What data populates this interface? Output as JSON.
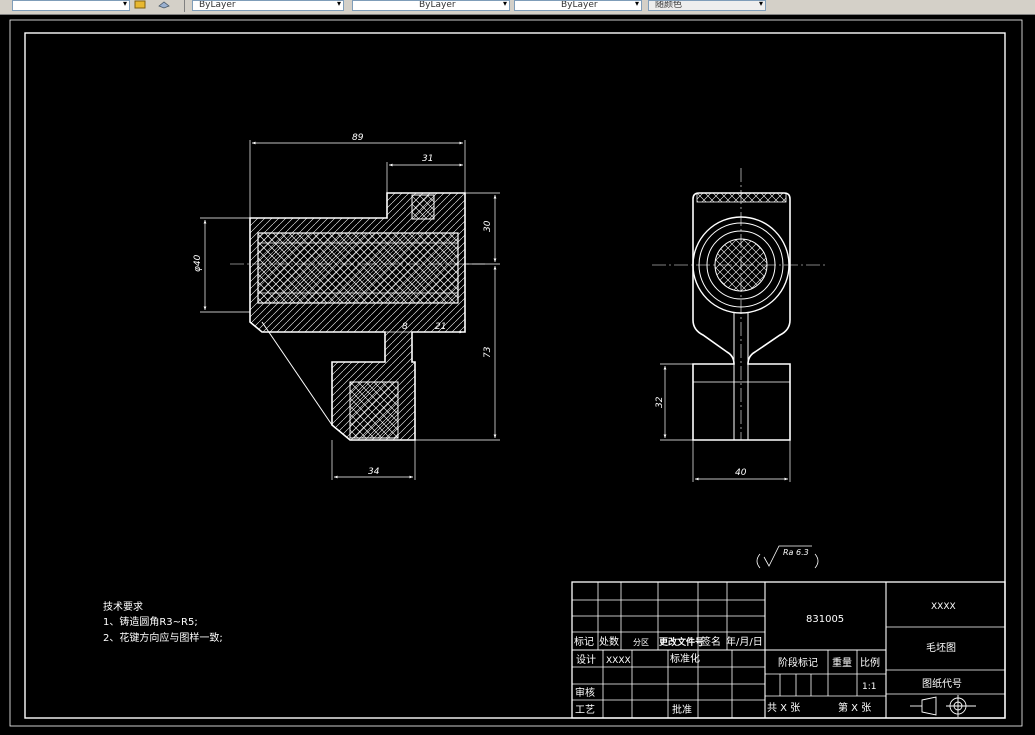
{
  "toolbar": {
    "layer_color": "ByLayer",
    "layer_linetype": "ByLayer",
    "layer_lineweight": "ByLayer",
    "plot_style": "随颜色"
  },
  "dimensions": {
    "d89": "89",
    "d31": "31",
    "d30": "30",
    "phi40": "φ40",
    "d8": "8",
    "d21": "21",
    "d73": "73",
    "d34": "34",
    "d32": "32",
    "d40": "40"
  },
  "roughness": {
    "label": "Ra 6.3"
  },
  "tech_requirements": {
    "title": "技术要求",
    "item1": "1、铸造圆角R3~R5;",
    "item2": "2、花键方向应与图样一致;"
  },
  "title_block": {
    "drawing_no": "831005",
    "company": "XXXX",
    "name": "毛坯图",
    "code_label": "图纸代号",
    "h_mark": "标记",
    "h_count": "处数",
    "h_zone": "分区",
    "h_docno": "更改文件号",
    "h_sign": "签名",
    "h_date": "年/月/日",
    "design": "设计",
    "designer": "XXXX",
    "standardize": "标准化",
    "review": "审核",
    "process": "工艺",
    "approve": "批准",
    "stage_mark": "阶段标记",
    "weight": "重量",
    "ratio_label": "比例",
    "ratio": "1:1",
    "total": "共 X 张",
    "sheet": "第 X 张"
  }
}
